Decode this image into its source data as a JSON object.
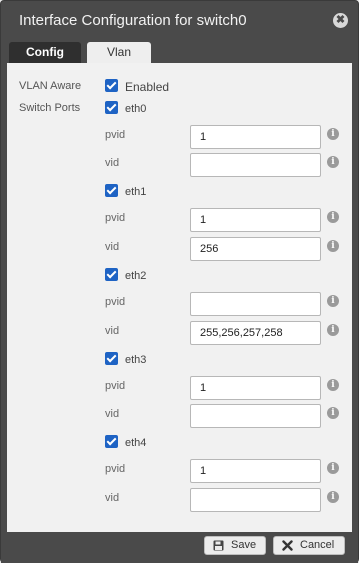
{
  "dialog": {
    "title": "Interface Configuration for switch0",
    "close_glyph": "✖"
  },
  "tabs": [
    {
      "label": "Config",
      "active": true
    },
    {
      "label": "Vlan",
      "active": false
    }
  ],
  "form": {
    "vlan_aware_label": "VLAN Aware",
    "vlan_aware_option": "Enabled",
    "vlan_aware_checked": true,
    "switch_ports_label": "Switch Ports",
    "ports": [
      {
        "name": "eth0",
        "checked": true,
        "pvid_label": "pvid",
        "pvid": "1",
        "vid_label": "vid",
        "vid": ""
      },
      {
        "name": "eth1",
        "checked": true,
        "pvid_label": "pvid",
        "pvid": "1",
        "vid_label": "vid",
        "vid": "256"
      },
      {
        "name": "eth2",
        "checked": true,
        "pvid_label": "pvid",
        "pvid": "",
        "vid_label": "vid",
        "vid": "255,256,257,258"
      },
      {
        "name": "eth3",
        "checked": true,
        "pvid_label": "pvid",
        "pvid": "1",
        "vid_label": "vid",
        "vid": ""
      },
      {
        "name": "eth4",
        "checked": true,
        "pvid_label": "pvid",
        "pvid": "1",
        "vid_label": "vid",
        "vid": ""
      }
    ],
    "info_glyph": "i"
  },
  "footer": {
    "save_label": "Save",
    "save_icon": "floppy-icon",
    "cancel_label": "Cancel",
    "cancel_icon": "x-icon"
  },
  "colors": {
    "checkbox": "#1e63c4",
    "chrome": "#4a4a4a"
  }
}
